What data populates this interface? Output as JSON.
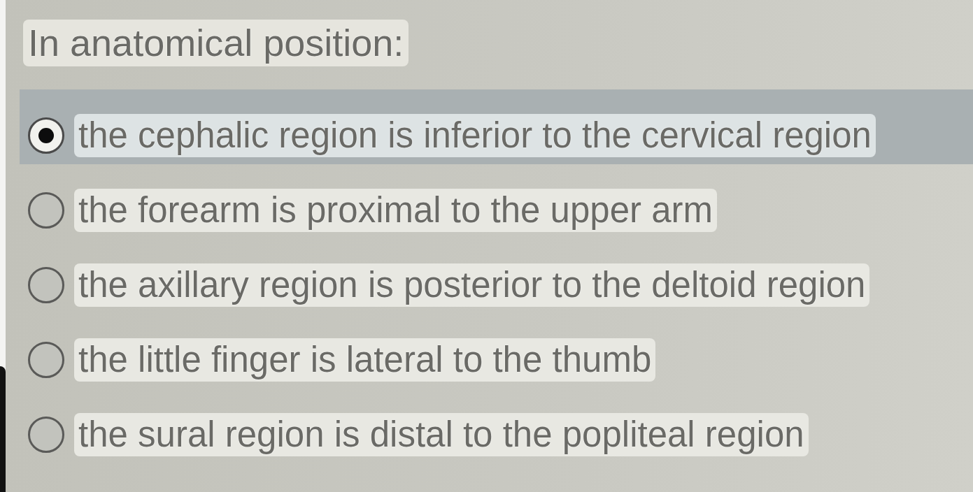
{
  "question": {
    "text": "In anatomical position:"
  },
  "options": [
    {
      "label": "the cephalic region is inferior to the cervical region",
      "selected": true
    },
    {
      "label": "the forearm is proximal to the upper arm",
      "selected": false
    },
    {
      "label": "the axillary region is posterior to the deltoid region",
      "selected": false
    },
    {
      "label": "the little finger is lateral to the thumb",
      "selected": false
    },
    {
      "label": "the sural region is distal to the popliteal region",
      "selected": false
    }
  ]
}
